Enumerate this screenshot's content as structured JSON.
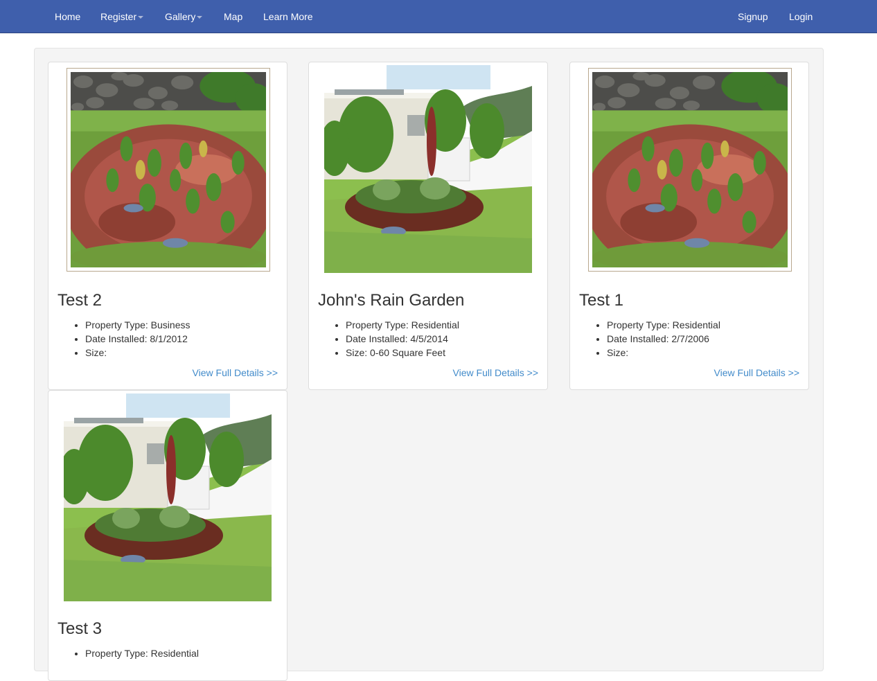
{
  "nav": {
    "left": [
      {
        "label": "Home"
      },
      {
        "label": "Register",
        "dropdown": true
      },
      {
        "label": "Gallery",
        "dropdown": true
      },
      {
        "label": "Map"
      },
      {
        "label": "Learn More"
      }
    ],
    "right": [
      {
        "label": "Signup"
      },
      {
        "label": "Login"
      }
    ]
  },
  "gallery": {
    "cards": [
      {
        "title": "Test 2",
        "photo": "rain-garden-mulch-bed",
        "info": [
          "Property Type: Business",
          "Date Installed: 8/1/2012",
          "Size:"
        ],
        "link": "View Full Details >>"
      },
      {
        "title": "John's Rain Garden",
        "photo": "rain-garden-house-yard",
        "info": [
          "Property Type: Residential",
          "Date Installed: 4/5/2014",
          "Size: 0-60 Square Feet"
        ],
        "link": "View Full Details >>"
      },
      {
        "title": "Test 1",
        "photo": "rain-garden-mulch-bed",
        "info": [
          "Property Type: Residential",
          "Date Installed: 2/7/2006",
          "Size:"
        ],
        "link": "View Full Details >>"
      },
      {
        "title": "Test 3",
        "photo": "rain-garden-house-yard",
        "info": [
          "Property Type: Residential"
        ],
        "link": ""
      }
    ]
  }
}
